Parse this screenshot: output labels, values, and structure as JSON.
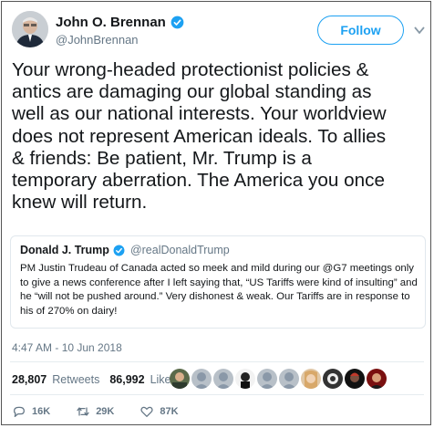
{
  "author": {
    "display_name": "John O. Brennan",
    "handle": "@JohnBrennan"
  },
  "follow_label": "Follow",
  "tweet_text": "Your wrong-headed protectionist policies &\nantics are damaging our global standing as\nwell as our national interests. Your worldview\ndoes not represent American ideals. To allies\n& friends: Be patient, Mr. Trump is a\ntemporary aberration. The America you once\nknew will return.",
  "quoted": {
    "display_name": "Donald J. Trump",
    "handle": "@realDonaldTrump",
    "text": "PM Justin Trudeau of Canada acted so meek and mild during our @G7 meetings only to give a news conference after I left saying that, “US Tariffs were kind of insulting” and he “will not be pushed around.” Very dishonest & weak. Our Tariffs are in response to his of 270% on dairy!"
  },
  "timestamp": "4:47 AM - 10 Jun 2018",
  "stats": {
    "retweets_count": "28,807",
    "retweets_label": "Retweets",
    "likes_count": "86,992",
    "likes_label": "Likes"
  },
  "actions": {
    "replies": "16K",
    "retweets": "29K",
    "likes": "87K"
  },
  "colors": {
    "accent": "#1da1f2",
    "secondary_text": "#657786",
    "border": "#e1e8ed"
  },
  "icons": [
    "verified-badge-icon",
    "chevron-down-icon",
    "reply-icon",
    "retweet-icon",
    "like-icon"
  ]
}
